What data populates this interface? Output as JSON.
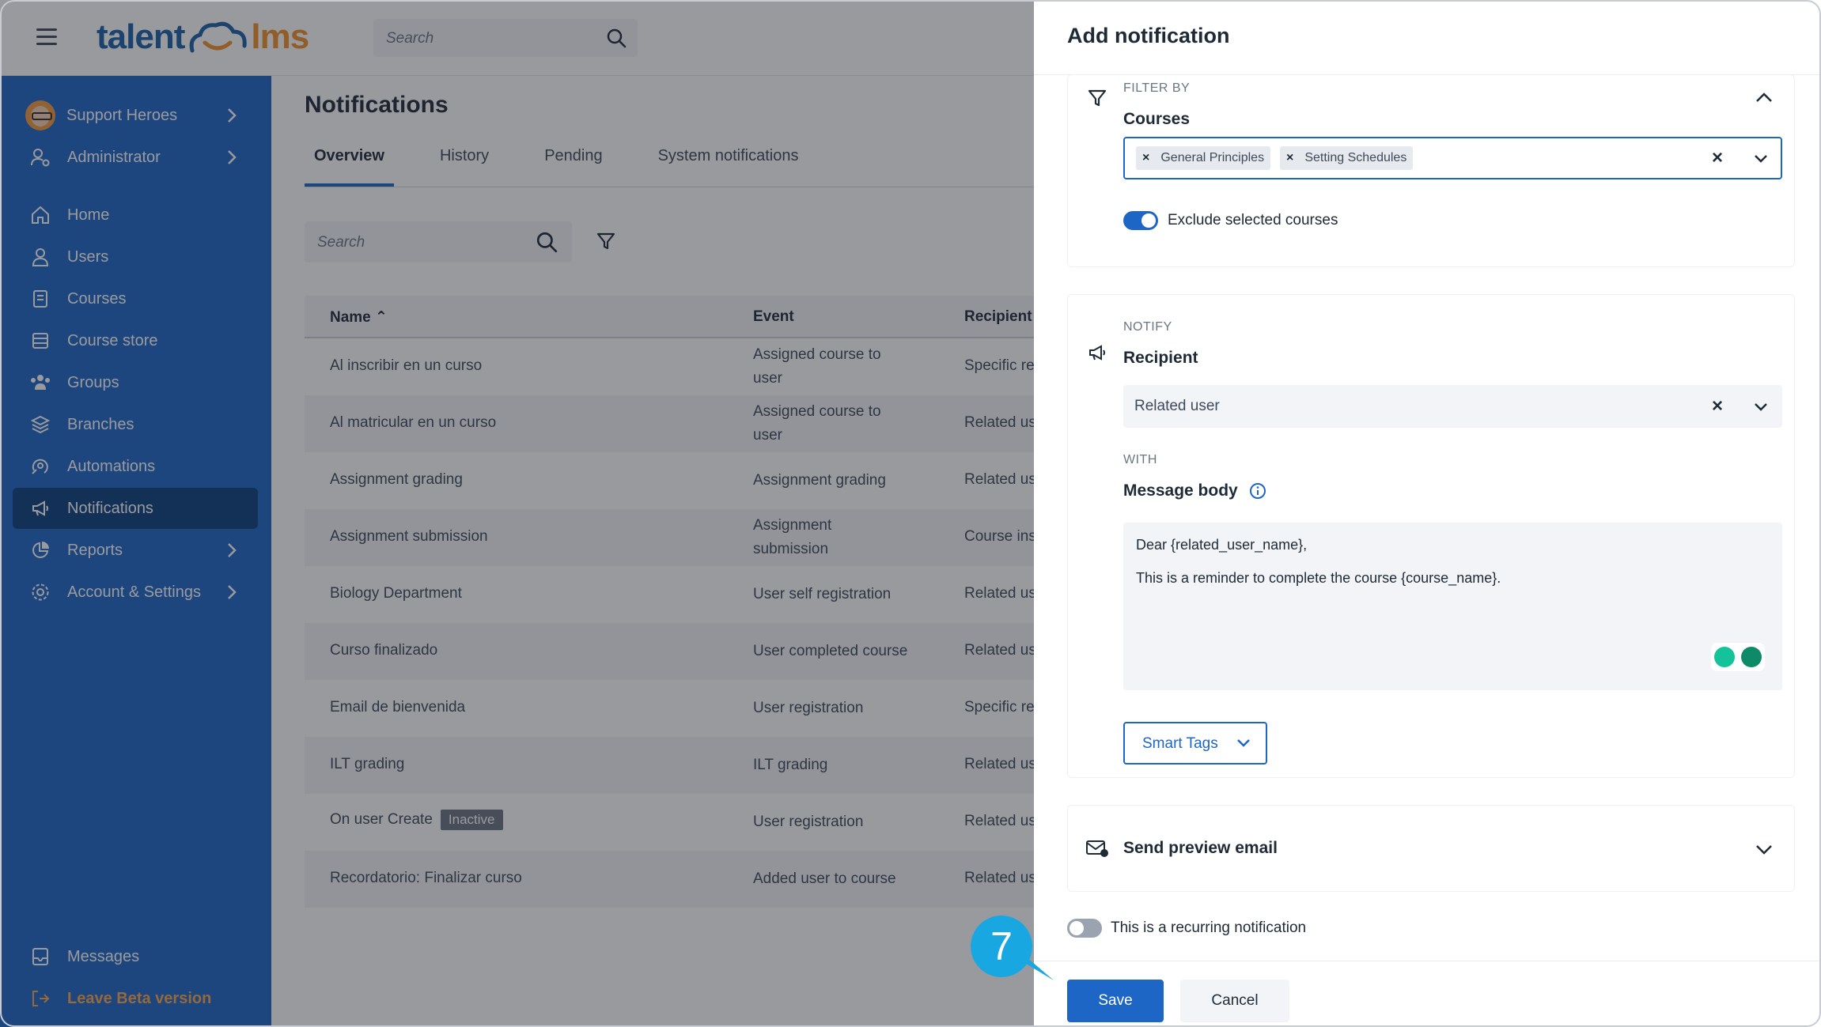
{
  "header": {
    "logo_left": "talent",
    "logo_right": "lms",
    "search_placeholder": "Search"
  },
  "sidebar": {
    "account": {
      "label": "Support Heroes"
    },
    "role": {
      "label": "Administrator"
    },
    "items": [
      {
        "label": "Home",
        "icon": "home-icon"
      },
      {
        "label": "Users",
        "icon": "user-icon"
      },
      {
        "label": "Courses",
        "icon": "book-icon"
      },
      {
        "label": "Course store",
        "icon": "store-icon"
      },
      {
        "label": "Groups",
        "icon": "groups-icon"
      },
      {
        "label": "Branches",
        "icon": "layers-icon"
      },
      {
        "label": "Automations",
        "icon": "automation-icon"
      },
      {
        "label": "Notifications",
        "icon": "megaphone-icon",
        "active": true
      },
      {
        "label": "Reports",
        "icon": "pie-chart-icon"
      },
      {
        "label": "Account & Settings",
        "icon": "gear-icon"
      }
    ],
    "messages": {
      "label": "Messages"
    },
    "beta": {
      "label": "Leave Beta version"
    }
  },
  "main": {
    "title": "Notifications",
    "tabs": [
      {
        "label": "Overview",
        "active": true
      },
      {
        "label": "History"
      },
      {
        "label": "Pending"
      },
      {
        "label": "System notifications"
      }
    ],
    "search_placeholder": "Search",
    "table": {
      "headers": {
        "name": "Name",
        "event": "Event",
        "recipient": "Recipient"
      },
      "rows": [
        {
          "name": "Al inscribir en un curso",
          "event": "Assigned course to user",
          "recipient": "Specific re"
        },
        {
          "name": "Al matricular en un curso",
          "event": "Assigned course to user",
          "recipient": "Related us"
        },
        {
          "name": "Assignment grading",
          "event": "Assignment grading",
          "recipient": "Related us"
        },
        {
          "name": "Assignment submission",
          "event": "Assignment submission",
          "recipient": "Course ins"
        },
        {
          "name": "Biology Department",
          "event": "User self registration",
          "recipient": "Related us"
        },
        {
          "name": "Curso finalizado",
          "event": "User completed course",
          "recipient": "Related us"
        },
        {
          "name": "Email de bienvenida",
          "event": "User registration",
          "recipient": "Specific re"
        },
        {
          "name": "ILT grading",
          "event": "ILT grading",
          "recipient": "Related us"
        },
        {
          "name": "On user Create",
          "badge": "Inactive",
          "event": "User registration",
          "recipient": "Related us"
        },
        {
          "name": "Recordatorio: Finalizar curso",
          "event": "Added user to course",
          "recipient": "Related us"
        }
      ]
    }
  },
  "panel": {
    "title": "Add notification",
    "filter": {
      "section_label": "FILTER BY",
      "title": "Courses",
      "chips": [
        "General Principles",
        "Setting Schedules"
      ],
      "exclude_label": "Exclude selected courses",
      "exclude_on": true
    },
    "notify": {
      "section_label": "NOTIFY",
      "title": "Recipient",
      "value": "Related user",
      "with_label": "WITH",
      "message_title": "Message body",
      "message_line1": "Dear {related_user_name},",
      "message_line2": "This is a reminder to complete the course {course_name}.",
      "smart_tags": "Smart Tags"
    },
    "preview": {
      "label": "Send preview email"
    },
    "recurring": {
      "label": "This is a recurring notification",
      "on": false
    },
    "save_label": "Save",
    "cancel_label": "Cancel"
  },
  "callout": {
    "step": "7",
    "color": "#19a7e2"
  },
  "colors": {
    "brand": "#1e66c5",
    "sidebar_active": "#0b3f7e",
    "beta": "#f6a64b",
    "logo_orange": "#f1912b"
  }
}
